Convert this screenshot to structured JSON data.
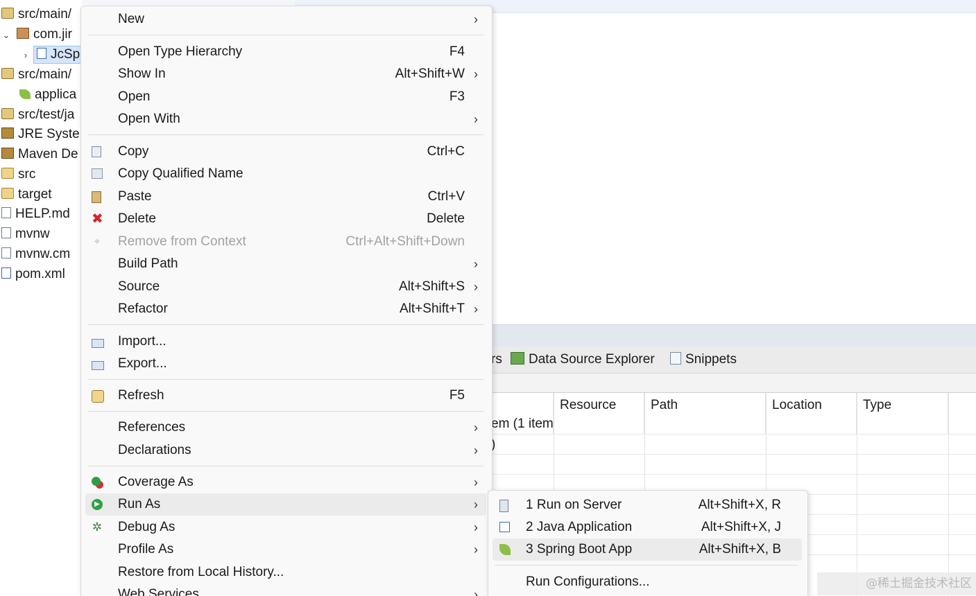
{
  "explorer": {
    "items": [
      {
        "label": "src/main/",
        "icon": "source-folder-icon",
        "twisty": ""
      },
      {
        "label": "com.jir",
        "icon": "package-icon",
        "twisty": "⌄"
      },
      {
        "label": "JcSp",
        "icon": "java-file-icon",
        "twisty": "›"
      },
      {
        "label": "src/main/",
        "icon": "source-folder-icon",
        "twisty": ""
      },
      {
        "label": "applica",
        "icon": "spring-leaf-icon",
        "twisty": ""
      },
      {
        "label": "src/test/ja",
        "icon": "source-folder-icon",
        "twisty": ""
      },
      {
        "label": "JRE Syste",
        "icon": "library-icon",
        "twisty": ""
      },
      {
        "label": "Maven De",
        "icon": "library-icon",
        "twisty": ""
      },
      {
        "label": "src",
        "icon": "folder-icon",
        "twisty": ""
      },
      {
        "label": "target",
        "icon": "folder-icon",
        "twisty": ""
      },
      {
        "label": "HELP.md",
        "icon": "markdown-file-icon",
        "twisty": ""
      },
      {
        "label": "mvnw",
        "icon": "file-icon",
        "twisty": ""
      },
      {
        "label": "mvnw.cm",
        "icon": "file-icon",
        "twisty": ""
      },
      {
        "label": "pom.xml",
        "icon": "maven-file-icon",
        "twisty": ""
      }
    ]
  },
  "views": {
    "tabs": [
      {
        "label": "rs",
        "icon": ""
      },
      {
        "label": "Data Source Explorer",
        "icon": "data-source-icon"
      },
      {
        "label": "Snippets",
        "icon": "snippets-icon"
      }
    ],
    "columns": [
      "Resource",
      "Path",
      "Location",
      "Type"
    ],
    "rows": [
      {
        "first": "em (1 item"
      },
      {
        "first": ")"
      }
    ]
  },
  "context_menu": {
    "items": [
      {
        "label": "New",
        "accel": "",
        "submenu": true,
        "icon": ""
      },
      {
        "label": "Open Type Hierarchy",
        "accel": "F4",
        "submenu": false,
        "icon": ""
      },
      {
        "label": "Show In",
        "accel": "Alt+Shift+W",
        "submenu": true,
        "icon": ""
      },
      {
        "label": "Open",
        "accel": "F3",
        "submenu": false,
        "icon": ""
      },
      {
        "label": "Open With",
        "accel": "",
        "submenu": true,
        "icon": ""
      },
      {
        "label": "Copy",
        "accel": "Ctrl+C",
        "submenu": false,
        "icon": "copy-icon"
      },
      {
        "label": "Copy Qualified Name",
        "accel": "",
        "submenu": false,
        "icon": "copy-qualified-name-icon"
      },
      {
        "label": "Paste",
        "accel": "Ctrl+V",
        "submenu": false,
        "icon": "paste-icon"
      },
      {
        "label": "Delete",
        "accel": "Delete",
        "submenu": false,
        "icon": "delete-icon"
      },
      {
        "label": "Remove from Context",
        "accel": "Ctrl+Alt+Shift+Down",
        "submenu": false,
        "icon": "remove-from-context-icon",
        "disabled": true
      },
      {
        "label": "Build Path",
        "accel": "",
        "submenu": true,
        "icon": ""
      },
      {
        "label": "Source",
        "accel": "Alt+Shift+S",
        "submenu": true,
        "icon": ""
      },
      {
        "label": "Refactor",
        "accel": "Alt+Shift+T",
        "submenu": true,
        "icon": ""
      },
      {
        "label": "Import...",
        "accel": "",
        "submenu": false,
        "icon": "import-icon"
      },
      {
        "label": "Export...",
        "accel": "",
        "submenu": false,
        "icon": "export-icon"
      },
      {
        "label": "Refresh",
        "accel": "F5",
        "submenu": false,
        "icon": "refresh-icon"
      },
      {
        "label": "References",
        "accel": "",
        "submenu": true,
        "icon": ""
      },
      {
        "label": "Declarations",
        "accel": "",
        "submenu": true,
        "icon": ""
      },
      {
        "label": "Coverage As",
        "accel": "",
        "submenu": true,
        "icon": "coverage-icon"
      },
      {
        "label": "Run As",
        "accel": "",
        "submenu": true,
        "icon": "run-icon",
        "active": true
      },
      {
        "label": "Debug As",
        "accel": "",
        "submenu": true,
        "icon": "debug-icon"
      },
      {
        "label": "Profile As",
        "accel": "",
        "submenu": true,
        "icon": ""
      },
      {
        "label": "Restore from Local History...",
        "accel": "",
        "submenu": false,
        "icon": ""
      },
      {
        "label": "Web Services",
        "accel": "",
        "submenu": true,
        "icon": ""
      }
    ],
    "arrow_glyph": "›"
  },
  "run_as_submenu": {
    "items": [
      {
        "label": "1 Run on Server",
        "accel": "Alt+Shift+X, R",
        "icon": "server-icon"
      },
      {
        "label": "2 Java Application",
        "accel": "Alt+Shift+X, J",
        "icon": "java-application-icon"
      },
      {
        "label": "3 Spring Boot App",
        "accel": "Alt+Shift+X, B",
        "icon": "spring-boot-icon",
        "highlighted": true
      },
      {
        "label": "Run Configurations...",
        "accel": "",
        "icon": ""
      }
    ]
  },
  "watermark": "@稀土掘金技术社区"
}
